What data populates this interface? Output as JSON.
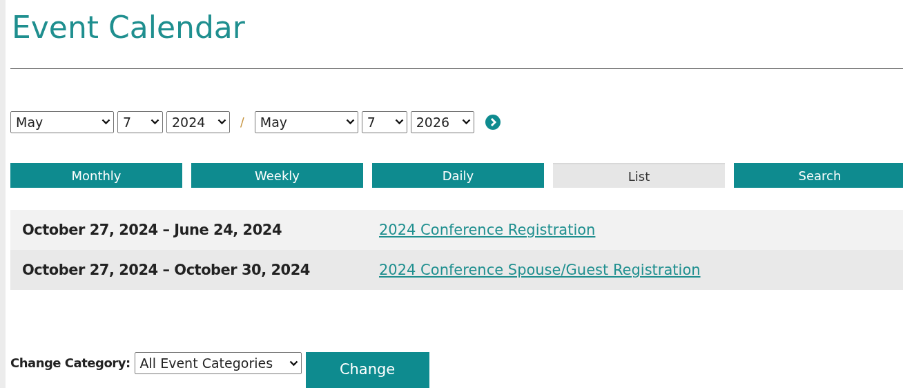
{
  "title": "Event Calendar",
  "date_range": {
    "start": {
      "month": "May",
      "day": "7",
      "year": "2024"
    },
    "separator": "/",
    "end": {
      "month": "May",
      "day": "7",
      "year": "2026"
    }
  },
  "tabs": [
    {
      "label": "Monthly",
      "selected": false
    },
    {
      "label": "Weekly",
      "selected": false
    },
    {
      "label": "Daily",
      "selected": false
    },
    {
      "label": "List",
      "selected": true
    },
    {
      "label": "Search",
      "selected": false
    }
  ],
  "events": [
    {
      "dates": "October 27, 2024 – June 24, 2024",
      "title": "2024 Conference Registration"
    },
    {
      "dates": "October 27, 2024 – October 30, 2024",
      "title": "2024 Conference Spouse/Guest Registration"
    }
  ],
  "category": {
    "label": "Change Category:",
    "value": "All Event Categories",
    "button": "Change"
  }
}
